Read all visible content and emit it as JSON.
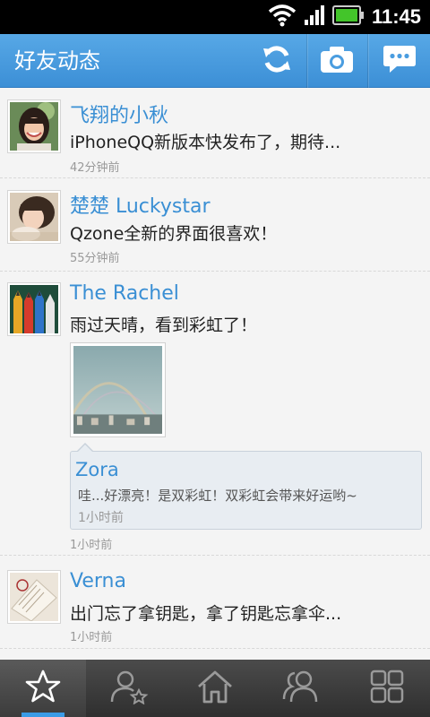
{
  "status_bar": {
    "time": "11:45",
    "icons": [
      "wifi-icon",
      "signal-icon",
      "battery-icon"
    ]
  },
  "header": {
    "title": "好友动态",
    "buttons": [
      "refresh-icon",
      "camera-icon",
      "message-icon"
    ]
  },
  "feed": [
    {
      "name": "飞翔的小秋",
      "text": "iPhoneQQ新版本快发布了，期待...",
      "time": "42分钟前"
    },
    {
      "name": "楚楚 Luckystar",
      "text": "Qzone全新的界面很喜欢！",
      "time": "55分钟前"
    },
    {
      "name": "The Rachel",
      "text": "雨过天晴，看到彩虹了！",
      "time": "1小时前",
      "comment": {
        "name": "Zora",
        "text": "哇...好漂亮！是双彩虹！双彩虹会带来好运哟~",
        "time": "1小时前"
      }
    },
    {
      "name": "Verna",
      "text": "出门忘了拿钥匙，拿了钥匙忘拿伞...",
      "time": "1小时前"
    }
  ],
  "tabs": [
    "star-icon",
    "user-star-icon",
    "home-icon",
    "friends-icon",
    "apps-grid-icon"
  ],
  "colors": {
    "accent": "#3a8fd4",
    "header": "#4a9de0",
    "tab_indicator": "#3a9be6",
    "tab_bar": "#3a3a3a"
  }
}
